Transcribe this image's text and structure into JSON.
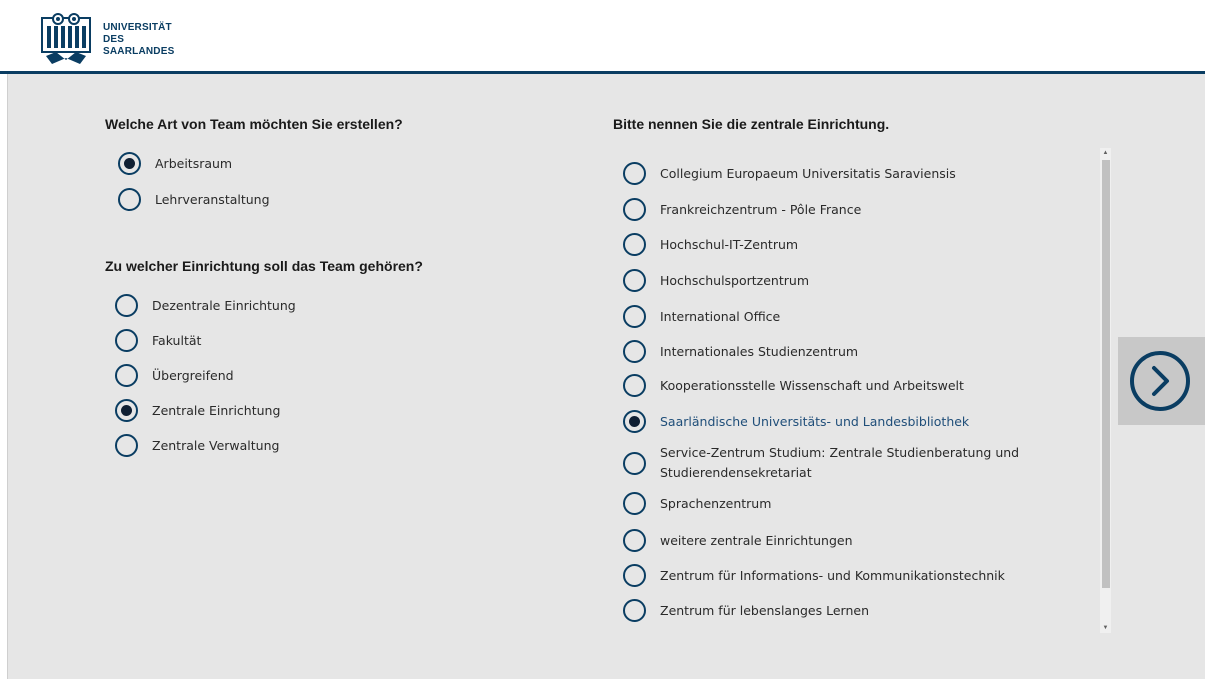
{
  "header": {
    "logo_line1": "UNIVERSITÄT",
    "logo_line2": "DES",
    "logo_line3": "SAARLANDES",
    "brand_color": "#0a3d62"
  },
  "team_type": {
    "heading": "Welche Art von Team möchten Sie erstellen?",
    "options": [
      {
        "label": "Arbeitsraum",
        "selected": true
      },
      {
        "label": "Lehrveranstaltung",
        "selected": false
      }
    ]
  },
  "institution_type": {
    "heading": "Zu welcher Einrichtung soll das Team gehören?",
    "options": [
      {
        "label": "Dezentrale Einrichtung",
        "selected": false
      },
      {
        "label": "Fakultät",
        "selected": false
      },
      {
        "label": "Übergreifend",
        "selected": false
      },
      {
        "label": "Zentrale Einrichtung",
        "selected": true
      },
      {
        "label": "Zentrale Verwaltung",
        "selected": false
      }
    ]
  },
  "central_institution": {
    "heading": "Bitte nennen Sie die zentrale Einrichtung.",
    "options": [
      {
        "label": "Collegium Europaeum Universitatis Saraviensis",
        "selected": false
      },
      {
        "label": "Frankreichzentrum - Pôle France",
        "selected": false
      },
      {
        "label": "Hochschul-IT-Zentrum",
        "selected": false
      },
      {
        "label": "Hochschulsportzentrum",
        "selected": false
      },
      {
        "label": "International Office",
        "selected": false
      },
      {
        "label": "Internationales Studienzentrum",
        "selected": false
      },
      {
        "label": "Kooperationsstelle Wissenschaft und Arbeitswelt",
        "selected": false
      },
      {
        "label": "Saarländische Universitäts- und Landesbibliothek",
        "selected": true
      },
      {
        "label": "Service-Zentrum Studium: Zentrale Studienberatung und Studierendensekretariat",
        "selected": false
      },
      {
        "label": "Sprachenzentrum",
        "selected": false
      },
      {
        "label": "weitere zentrale Einrichtungen",
        "selected": false
      },
      {
        "label": "Zentrum für Informations- und Kommunikationstechnik",
        "selected": false
      },
      {
        "label": "Zentrum für lebenslanges Lernen",
        "selected": false
      }
    ]
  },
  "next_button": {
    "icon": "chevron-right-icon"
  }
}
